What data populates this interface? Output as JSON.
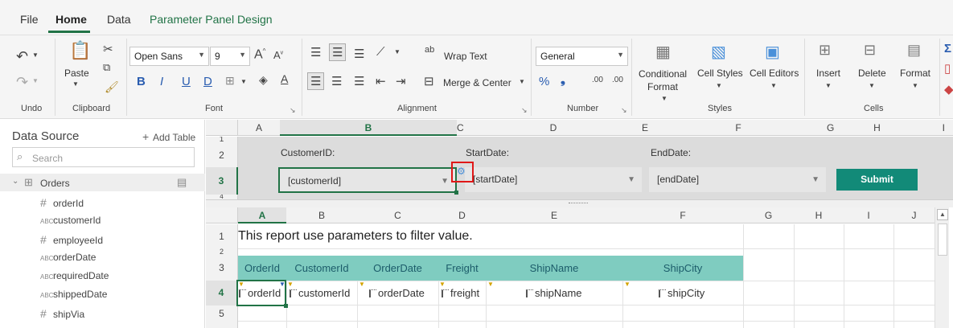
{
  "tabs": [
    "File",
    "Home",
    "Data",
    "Parameter Panel Design"
  ],
  "ribbon": {
    "undo_label": "Undo",
    "clipboard_label": "Clipboard",
    "paste_label": "Paste",
    "font_name": "Open Sans",
    "font_size": "9",
    "font_label": "Font",
    "alignment_label": "Alignment",
    "wrap_text": "Wrap Text",
    "merge_center": "Merge & Center",
    "number_format": "General",
    "number_label": "Number",
    "conditional_format": [
      "Conditional",
      "Format"
    ],
    "cell_styles": "Cell Styles",
    "cell_editors": "Cell Editors",
    "styles_label": "Styles",
    "insert": "Insert",
    "delete": "Delete",
    "format": "Format",
    "cells_label": "Cells"
  },
  "data_source": {
    "title": "Data Source",
    "add_table": "Add Table",
    "search_placeholder": "Search",
    "table_name": "Orders",
    "fields": [
      {
        "type": "#",
        "name": "orderId"
      },
      {
        "type": "ABC",
        "name": "customerId"
      },
      {
        "type": "#",
        "name": "employeeId"
      },
      {
        "type": "ABC",
        "name": "orderDate"
      },
      {
        "type": "ABC",
        "name": "requiredDate"
      },
      {
        "type": "ABC",
        "name": "shippedDate"
      },
      {
        "type": "#",
        "name": "shipVia"
      }
    ]
  },
  "param_panel": {
    "columns": [
      "A",
      "B",
      "C",
      "D",
      "E",
      "F",
      "G",
      "H",
      "I"
    ],
    "rows": [
      "1",
      "2",
      "3",
      "4"
    ],
    "labels": {
      "customer": "CustomerID:",
      "start": "StartDate:",
      "end": "EndDate:"
    },
    "inputs": {
      "customer": "[customerId]",
      "start": "[startDate]",
      "end": "[endDate]"
    },
    "submit": "Submit"
  },
  "sheet": {
    "columns": [
      "A",
      "B",
      "C",
      "D",
      "E",
      "F",
      "G",
      "H",
      "I",
      "J"
    ],
    "rows": [
      "1",
      "2",
      "3",
      "4",
      "5"
    ],
    "note": "This report use parameters to filter value.",
    "headers": [
      "OrderId",
      "CustomerId",
      "OrderDate",
      "Freight",
      "ShipName",
      "ShipCity"
    ],
    "fields": [
      "orderId",
      "customerId",
      "orderDate",
      "freight",
      "shipName",
      "shipCity"
    ]
  },
  "colors": {
    "accent": "#217346",
    "header_fill": "#7fccc0",
    "submit": "#128a78"
  }
}
